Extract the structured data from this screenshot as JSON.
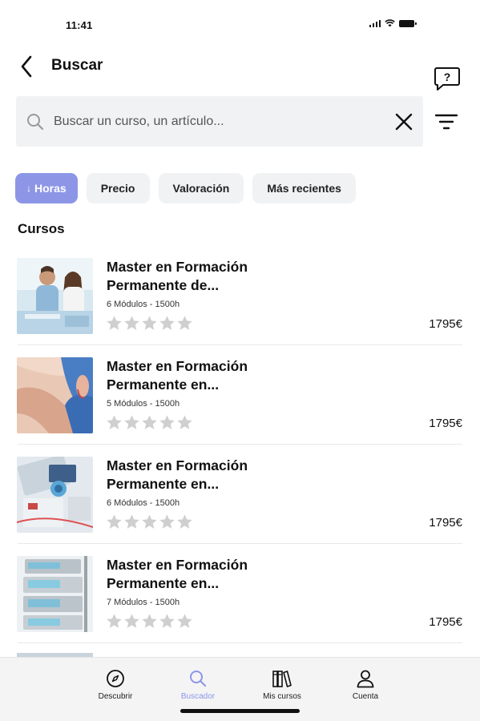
{
  "status_bar": {
    "time": "11:41"
  },
  "header": {
    "title": "Buscar"
  },
  "search": {
    "placeholder": "Buscar un curso, un artículo...",
    "value": ""
  },
  "filters": [
    {
      "label": "Horas",
      "active": true,
      "sort_icon": "arrow-down"
    },
    {
      "label": "Precio",
      "active": false
    },
    {
      "label": "Valoración",
      "active": false
    },
    {
      "label": "Más recientes",
      "active": false
    }
  ],
  "section": {
    "title": "Cursos"
  },
  "courses": [
    {
      "title": "Master en Formación Permanente de...",
      "meta": "6 Módulos - 1500h",
      "price": "1795€",
      "rating": 0,
      "image": "people-meeting"
    },
    {
      "title": "Master en Formación Permanente en...",
      "meta": "5 Módulos - 1500h",
      "price": "1795€",
      "rating": 0,
      "image": "medical-leg"
    },
    {
      "title": "Master en Formación Permanente en...",
      "meta": "6 Módulos - 1500h",
      "price": "1795€",
      "rating": 0,
      "image": "medical-equipment"
    },
    {
      "title": "Master en Formación Permanente en...",
      "meta": "7 Módulos - 1500h",
      "price": "1795€",
      "rating": 0,
      "image": "infusion-pumps"
    }
  ],
  "tabs": [
    {
      "label": "Descubrir",
      "icon": "compass-icon",
      "active": false
    },
    {
      "label": "Buscador",
      "icon": "search-icon",
      "active": true
    },
    {
      "label": "Mis cursos",
      "icon": "books-icon",
      "active": false
    },
    {
      "label": "Cuenta",
      "icon": "user-icon",
      "active": false
    }
  ],
  "colors": {
    "accent": "#8d96e6",
    "chip_bg": "#f1f2f4",
    "star": "#cfcfcf"
  }
}
